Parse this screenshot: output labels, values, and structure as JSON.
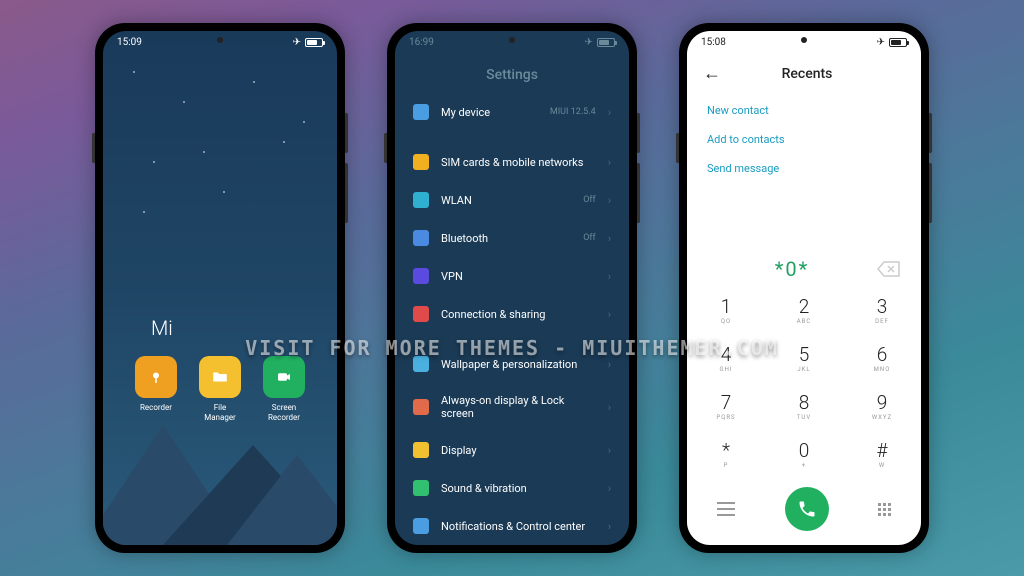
{
  "phone1": {
    "time": "15:09",
    "folder_title": "Mi",
    "apps": [
      {
        "label": "Recorder",
        "icon": "mic"
      },
      {
        "label": "File\nManager",
        "icon": "folder"
      },
      {
        "label": "Screen\nRecorder",
        "icon": "video"
      }
    ]
  },
  "phone2": {
    "time": "16:99",
    "title": "Settings",
    "items": [
      {
        "label": "My device",
        "value": "MIUI 12.5.4",
        "icon": "device"
      },
      {
        "gap": true
      },
      {
        "label": "SIM cards & mobile networks",
        "icon": "sim"
      },
      {
        "label": "WLAN",
        "value": "Off",
        "icon": "wifi"
      },
      {
        "label": "Bluetooth",
        "value": "Off",
        "icon": "bt"
      },
      {
        "label": "VPN",
        "icon": "vpn"
      },
      {
        "label": "Connection & sharing",
        "icon": "conn"
      },
      {
        "gap": true
      },
      {
        "label": "Wallpaper & personalization",
        "icon": "wall"
      },
      {
        "label": "Always-on display & Lock screen",
        "icon": "always"
      },
      {
        "label": "Display",
        "icon": "display"
      },
      {
        "label": "Sound & vibration",
        "icon": "sound"
      },
      {
        "label": "Notifications & Control center",
        "icon": "notif"
      }
    ]
  },
  "phone3": {
    "time": "15:08",
    "title": "Recents",
    "actions": [
      "New contact",
      "Add to contacts",
      "Send message"
    ],
    "dialed": "*0*",
    "keypad": [
      {
        "num": "1",
        "sub": "QO"
      },
      {
        "num": "2",
        "sub": "ABC"
      },
      {
        "num": "3",
        "sub": "DEF"
      },
      {
        "num": "4",
        "sub": "GHI"
      },
      {
        "num": "5",
        "sub": "JKL"
      },
      {
        "num": "6",
        "sub": "MNO"
      },
      {
        "num": "7",
        "sub": "PQRS"
      },
      {
        "num": "8",
        "sub": "TUV"
      },
      {
        "num": "9",
        "sub": "WXYZ"
      },
      {
        "num": "*",
        "sub": "P"
      },
      {
        "num": "0",
        "sub": "+"
      },
      {
        "num": "#",
        "sub": "W"
      }
    ]
  },
  "watermark": "VISIT FOR MORE THEMES - MIUITHEMER.COM"
}
